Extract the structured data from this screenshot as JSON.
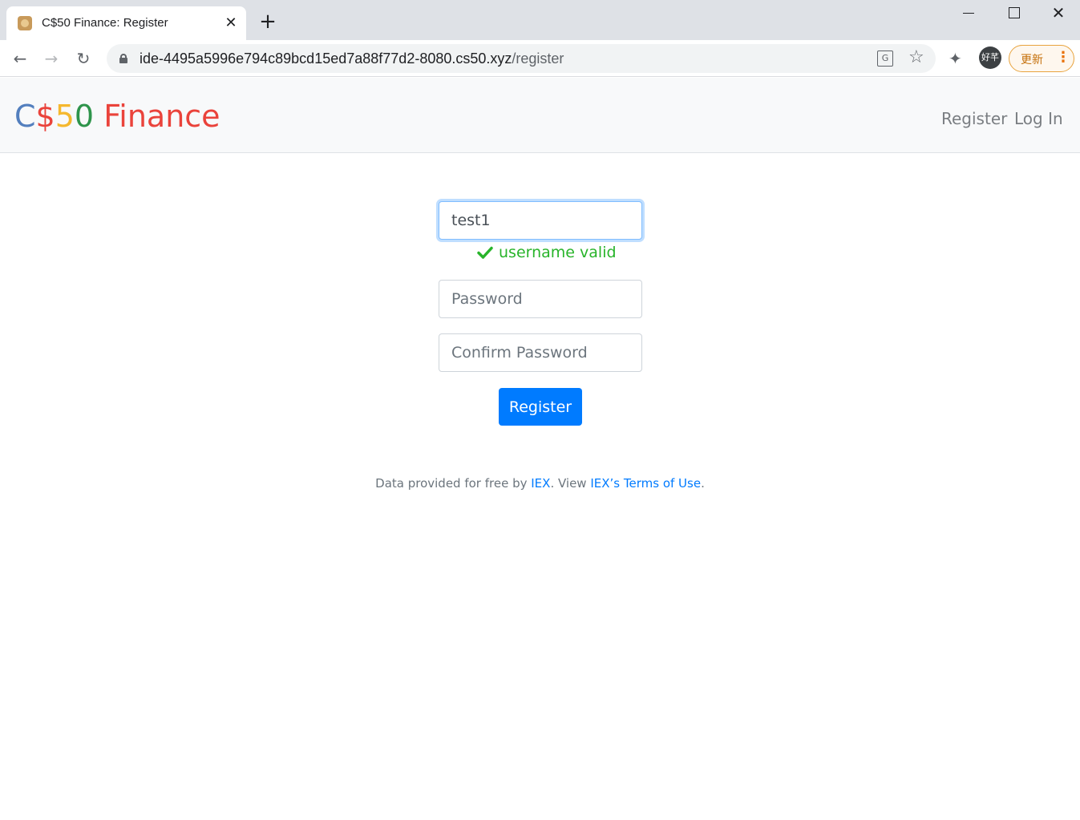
{
  "browser": {
    "tab_title": "C$50 Finance: Register",
    "url_host": "ide-4495a5996e794c89bcd15ed7a88f77d2-8080.cs50.xyz",
    "url_path": "/register",
    "update_label": "更新",
    "profile_label": "好芊"
  },
  "navbar": {
    "brand_parts": [
      "C",
      "$",
      "5",
      "0",
      " Finance"
    ],
    "links": {
      "register": "Register",
      "login": "Log In"
    }
  },
  "form": {
    "username_value": "test1",
    "username_status": "username valid",
    "password_placeholder": "Password",
    "confirm_placeholder": "Confirm Password",
    "submit_label": "Register"
  },
  "footer": {
    "prefix": "Data provided for free by ",
    "link1": "IEX",
    "middle": ". View ",
    "link2": "IEX’s Terms of Use",
    "suffix": "."
  },
  "colors": {
    "primary": "#007bff",
    "valid": "#28b42a",
    "brand_blue": "#537fbe",
    "brand_red": "#ea433b",
    "brand_yellow": "#f5b82e",
    "brand_green": "#2e944b"
  }
}
